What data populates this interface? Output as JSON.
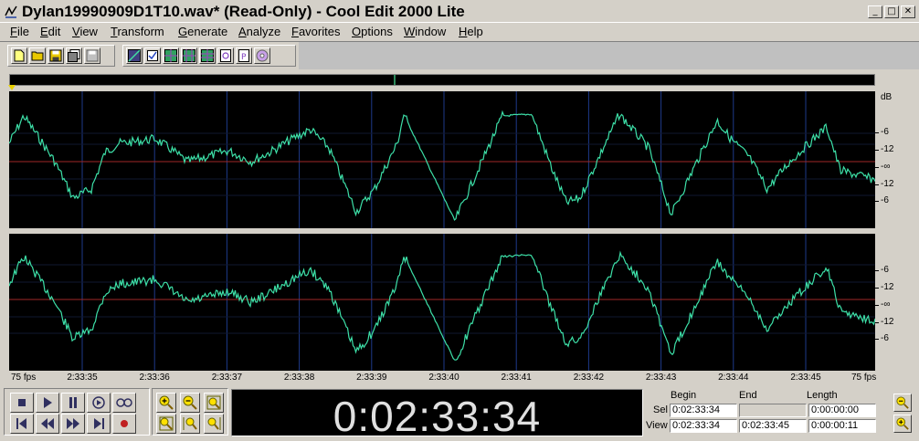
{
  "window": {
    "title": "Dylan19990909D1T10.wav* (Read-Only) - Cool Edit 2000 Lite",
    "controls": {
      "minimize": "_",
      "restore": "□",
      "close": "✕"
    }
  },
  "menu": [
    {
      "label": "File",
      "u": "F",
      "rest": "ile"
    },
    {
      "label": "Edit",
      "u": "E",
      "rest": "dit"
    },
    {
      "label": "View",
      "u": "V",
      "rest": "iew"
    },
    {
      "label": "Transform",
      "u": "T",
      "rest": "ransform"
    },
    {
      "label": "Generate",
      "u": "G",
      "rest": "enerate"
    },
    {
      "label": "Analyze",
      "u": "A",
      "rest": "nalyze"
    },
    {
      "label": "Favorites",
      "u": "F",
      "rest": "avorites"
    },
    {
      "label": "Options",
      "u": "O",
      "rest": "ptions"
    },
    {
      "label": "Window",
      "u": "W",
      "rest": "indow"
    },
    {
      "label": "Help",
      "u": "H",
      "rest": "elp"
    }
  ],
  "db_ruler": {
    "unit": "dB",
    "top_channel": [
      "-6",
      "-12",
      "-∞",
      "-12",
      "-6"
    ],
    "bottom_channel": [
      "-6",
      "-12",
      "-∞",
      "-12",
      "-6"
    ]
  },
  "time_ruler": {
    "start": "75 fps",
    "end": "75 fps",
    "ticks": [
      "2:33:35",
      "2:33:36",
      "2:33:37",
      "2:33:38",
      "2:33:39",
      "2:33:40",
      "2:33:41",
      "2:33:42",
      "2:33:43",
      "2:33:44",
      "2:33:45"
    ]
  },
  "time_display": "0:02:33:34",
  "selection": {
    "headers": {
      "begin": "Begin",
      "end": "End",
      "length": "Length"
    },
    "sel_label": "Sel",
    "view_label": "View",
    "sel": {
      "begin": "0:02:33:34",
      "end": "",
      "length": "0:00:00:00"
    },
    "view": {
      "begin": "0:02:33:34",
      "end": "0:02:33:45",
      "length": "0:00:00:11"
    }
  },
  "colors": {
    "waveform": "#3de0a8",
    "center_line": "#a02828",
    "grid": "#1e3a8a",
    "background": "#000000"
  }
}
